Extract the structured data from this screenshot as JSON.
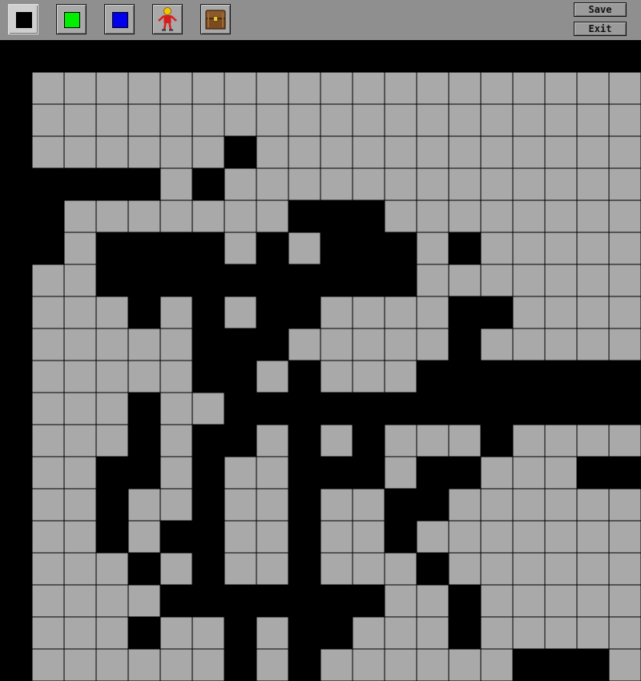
{
  "toolbar": {
    "tools": [
      {
        "name": "black-tile-tool",
        "color": "#000000",
        "selected": true
      },
      {
        "name": "green-tile-tool",
        "color": "#00ee00",
        "selected": false
      },
      {
        "name": "blue-tile-tool",
        "color": "#0000ee",
        "selected": false
      },
      {
        "name": "player-tool",
        "icon": "player-sprite-icon",
        "selected": false
      },
      {
        "name": "treasure-chest-tool",
        "icon": "treasure-chest-icon",
        "selected": false
      }
    ],
    "save_label": "Save",
    "exit_label": "Exit"
  },
  "colors": {
    "toolbar": "#8f8f8f",
    "floor": "#a9a9a9",
    "wall": "#000000",
    "gridline": "#000000"
  },
  "map": {
    "legend": {
      "#": "wall",
      ".": "floor"
    },
    "rows": [
      "####################",
      "#...................",
      "#...................",
      "#......#............",
      "#####.#.............",
      "##.......###........",
      "##.####.#.###.#.....",
      "#..##########.......",
      "#...#.#.##....##....",
      "#.....###.....#.....",
      "#.....##.#...#######",
      "#...#..#############",
      "#...#.##.#.#...#....",
      "#..##.#..###.##...##",
      "#..#..#..#..##......",
      "#..#.##..#..#.......",
      "#...#.#..#...#......",
      "#....#######..#.....",
      "#...#..#.##...#.....",
      "#......#.#......###."
    ]
  }
}
